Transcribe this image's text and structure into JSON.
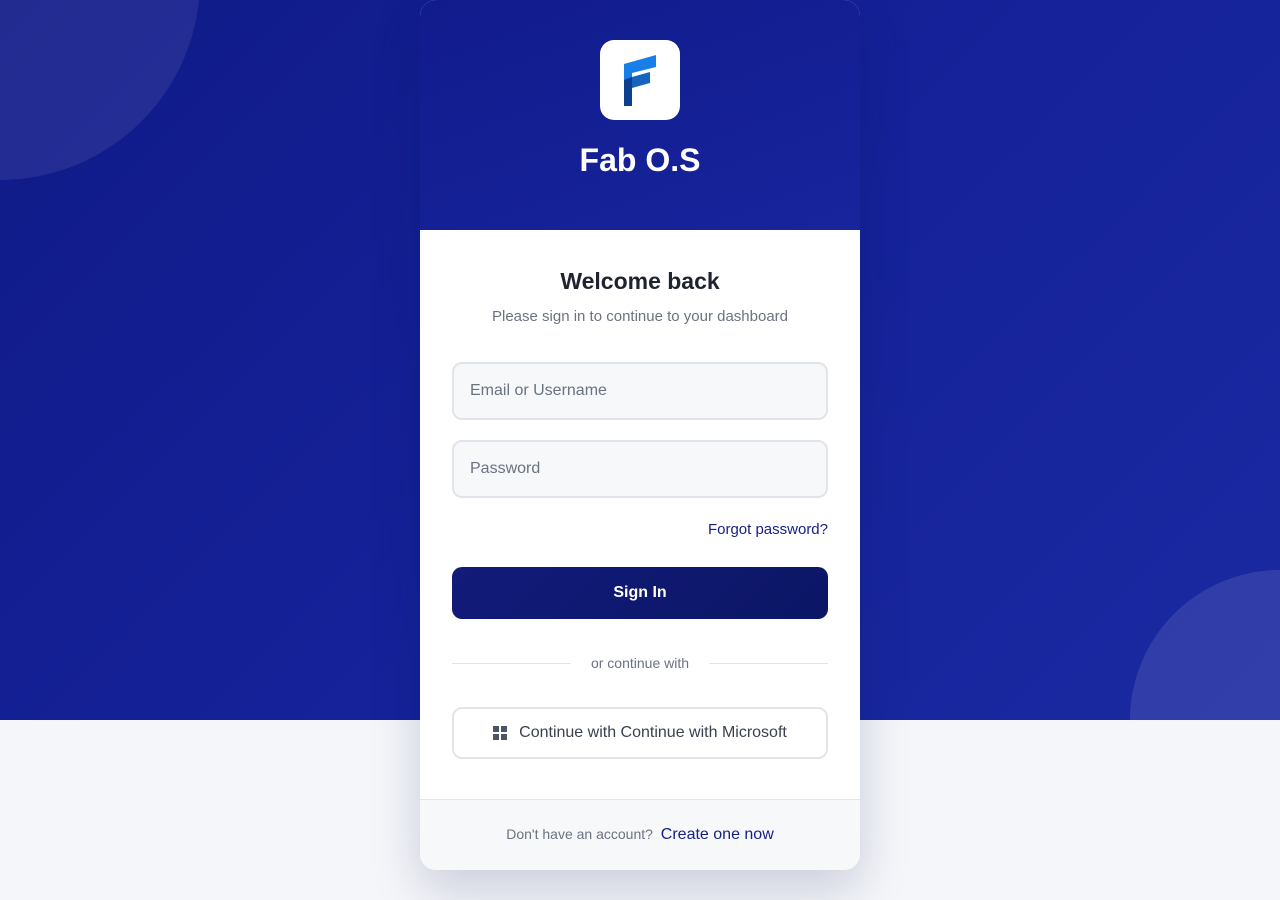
{
  "brand": {
    "title": "Fab O.S",
    "logo_icon": "fab-os-logo-icon"
  },
  "login": {
    "heading": "Welcome back",
    "subtitle": "Please sign in to continue to your dashboard",
    "email_placeholder": "Email or Username",
    "email_value": "",
    "password_placeholder": "Password",
    "password_value": "",
    "forgot_label": "Forgot password?",
    "signin_label": "Sign In",
    "divider_label": "or continue with",
    "microsoft_label": "Continue with Continue with Microsoft",
    "microsoft_icon": "windows-icon"
  },
  "footer": {
    "prompt": "Don't have an account?",
    "link_label": "Create one now"
  },
  "colors": {
    "background_top": "#121c8f",
    "primary": "#0f186f",
    "link": "#141e86",
    "page_bg": "#f5f6fa"
  }
}
